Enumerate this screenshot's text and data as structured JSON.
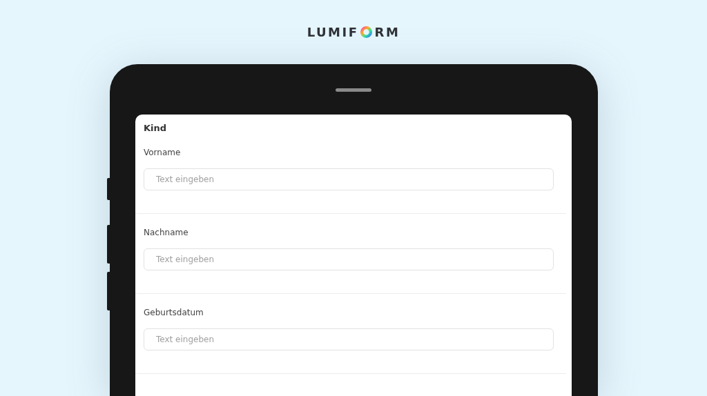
{
  "logo": {
    "text_before_mark": "LUMIF",
    "text_after_mark": "RM"
  },
  "form": {
    "title": "Kind",
    "fields": [
      {
        "label": "Vorname",
        "placeholder": "Text eingeben"
      },
      {
        "label": "Nachname",
        "placeholder": "Text eingeben"
      },
      {
        "label": "Geburtsdatum",
        "placeholder": "Text eingeben"
      }
    ]
  }
}
